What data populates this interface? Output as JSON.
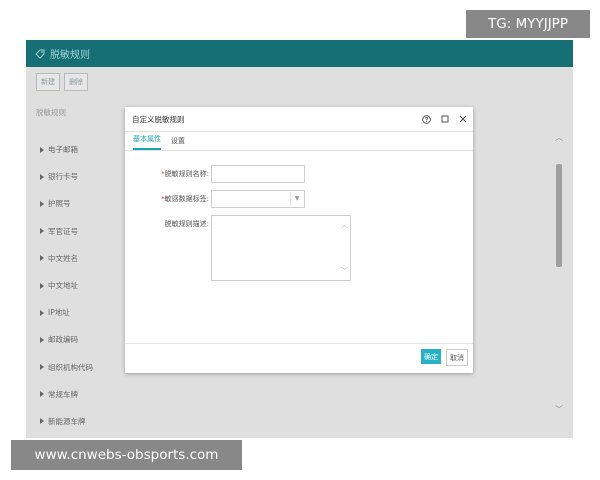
{
  "watermark_top": "TG: MYYJJPP",
  "watermark_bottom": "www.cnwebs-obsports.com",
  "app": {
    "title": "脱敏规则",
    "toolbar": {
      "new_label": "新建",
      "delete_label": "删除"
    },
    "section_label": "脱敏规则",
    "rules": [
      "电子邮箱",
      "银行卡号",
      "护照号",
      "军官证号",
      "中文姓名",
      "中文地址",
      "IP地址",
      "邮政编码",
      "组织机构代码",
      "常规车牌",
      "新能源车牌"
    ]
  },
  "dialog": {
    "title": "自定义脱敏规则",
    "tabs": [
      "基本属性",
      "设置"
    ],
    "fields": {
      "name_label": "脱敏规则名称:",
      "tag_label": "敏感数据标签:",
      "desc_label": "脱敏规则描述:",
      "required_mark": "*"
    },
    "confirm_label": "确定",
    "cancel_label": "取消"
  },
  "colors": {
    "titlebar": "#176f76",
    "accent": "#27b1c4",
    "overlay": "#dfdfdf"
  }
}
